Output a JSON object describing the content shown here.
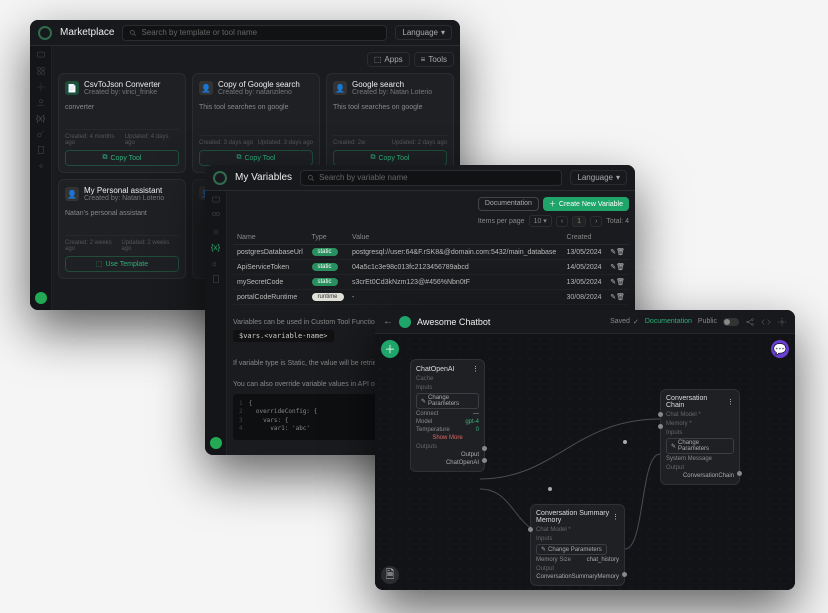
{
  "marketplace": {
    "title": "Marketplace",
    "search_placeholder": "Search by template or tool name",
    "language": "Language",
    "apps": "Apps",
    "tools": "Tools",
    "cards": [
      {
        "title": "CsvToJson Converter",
        "author": "Created by: virici_frinke",
        "desc": "converter",
        "created": "Created: 4 months ago",
        "updated": "Updated: 4 days ago",
        "action": "Copy Tool"
      },
      {
        "title": "Copy of Google search",
        "author": "Created by: natanzileno",
        "desc": "This tool searches on google",
        "created": "Created: 3 days ago",
        "updated": "Updated: 3 days ago",
        "action": "Copy Tool"
      },
      {
        "title": "Google search",
        "author": "Created by: Natan Loterio",
        "desc": "This tool searches on google",
        "created": "Created: 2w",
        "updated": "Updated: 2 days ago",
        "action": "Copy Tool"
      },
      {
        "title": "My Personal assistant",
        "author": "Created by: Natan Loterio",
        "desc": "Natan's personal assistant",
        "created": "Created: 2 weeks ago",
        "updated": "Updated: 2 weeks ago",
        "action": "Use Template"
      }
    ]
  },
  "variables": {
    "title": "My Variables",
    "search_placeholder": "Search by variable name",
    "language": "Language",
    "docs": "Documentation",
    "create": "Create New Variable",
    "items_per_page": "Items per page",
    "ipp_value": "10",
    "page": "1",
    "total_label": "Total: 4",
    "cols": {
      "name": "Name",
      "type": "Type",
      "value": "Value",
      "created": "Created"
    },
    "rows": [
      {
        "name": "postgresDatabaseUrl",
        "type": "static",
        "value": "postgresql://user:64&F.rSK8&@domain.com:5432/main_database",
        "created": "13/05/2024"
      },
      {
        "name": "ApiServiceToken",
        "type": "static",
        "value": "04a5c1c3e98c013fc2123456789abcd",
        "created": "14/05/2024"
      },
      {
        "name": "mySecretCode",
        "type": "static",
        "value": "s3crEt0Cd3kNzm123@#456%Nbn0tF",
        "created": "13/05/2024"
      },
      {
        "name": "portalCodeRuntime",
        "type": "runtime",
        "value": "-",
        "created": "30/08/2024"
      }
    ],
    "help1": "Variables can be used in Custom Tool Function with the $ prefix.",
    "help_code": "$vars.<variable-name>",
    "help2": "If variable type is Static, the value will be retrieved as it is. If variable type…",
    "help3": "You can also override variable values in API overrideConfig using vars…",
    "codeblock": "{\n  overrideConfig: {\n    vars: {\n      var1: 'abc'\n    }\n  }\n}"
  },
  "flow": {
    "title": "Awesome Chatbot",
    "saved": "Saved",
    "docs": "Documentation",
    "public": "Public",
    "nodes": {
      "chat": {
        "title": "ChatOpenAI",
        "cache": "Cache",
        "inputs": "Inputs",
        "change": "Change Parameters",
        "p1k": "Connect",
        "p1v": "—",
        "p2k": "Model",
        "p2v": "gpt-4",
        "p3k": "Temperature",
        "p3v": "0",
        "more": "Show More",
        "outputs": "Outputs",
        "out1": "Output",
        "out2": "ChatOpenAI"
      },
      "memory": {
        "title": "Conversation Summary Memory",
        "sub": "Chat Model *",
        "inputs": "Inputs",
        "change": "Change Parameters",
        "p1k": "Memory Size",
        "p1v": "chat_history",
        "outputs": "Output",
        "out1": "ConversationSummaryMemory"
      },
      "chain": {
        "title": "Conversation Chain",
        "sub2": "Chat Model *",
        "sub3": "Memory *",
        "inputs": "Inputs",
        "change": "Change Parameters",
        "p1k": "System Message",
        "outputs": "Output",
        "out1": "ConversationChain"
      }
    }
  }
}
